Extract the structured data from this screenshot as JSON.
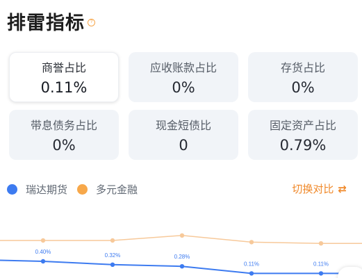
{
  "header": {
    "title": "排雷指标"
  },
  "cards": [
    {
      "label": "商誉占比",
      "value": "0.11%"
    },
    {
      "label": "应收账款占比",
      "value": "0%"
    },
    {
      "label": "存货占比",
      "value": "0%"
    },
    {
      "label": "带息债务占比",
      "value": "0%"
    },
    {
      "label": "现金短债比",
      "value": "0"
    },
    {
      "label": "固定资产占比",
      "value": "0.79%"
    }
  ],
  "legend": {
    "items": [
      {
        "label": "瑞达期货",
        "color": "#3d7bf0"
      },
      {
        "label": "多元金融",
        "color": "#f7a84a"
      }
    ],
    "switch_label": "切换对比",
    "switch_icon": "switch-compare-icon"
  },
  "chart_data": {
    "type": "line",
    "x": [
      "",
      "",
      "",
      "",
      ""
    ],
    "series": [
      {
        "name": "瑞达期货",
        "values": [
          0.4,
          0.32,
          0.28,
          0.11,
          0.11
        ],
        "labels": [
          "0.40%",
          "0.32%",
          "0.28%",
          "0.11%",
          "0.11%"
        ],
        "color": "#3d7bf0"
      },
      {
        "name": "多元金融",
        "values": [
          0.9,
          0.9,
          1.02,
          0.86,
          0.83
        ],
        "color": "#f7c99a"
      }
    ],
    "ylim": [
      0,
      1.5
    ],
    "grid": false
  }
}
